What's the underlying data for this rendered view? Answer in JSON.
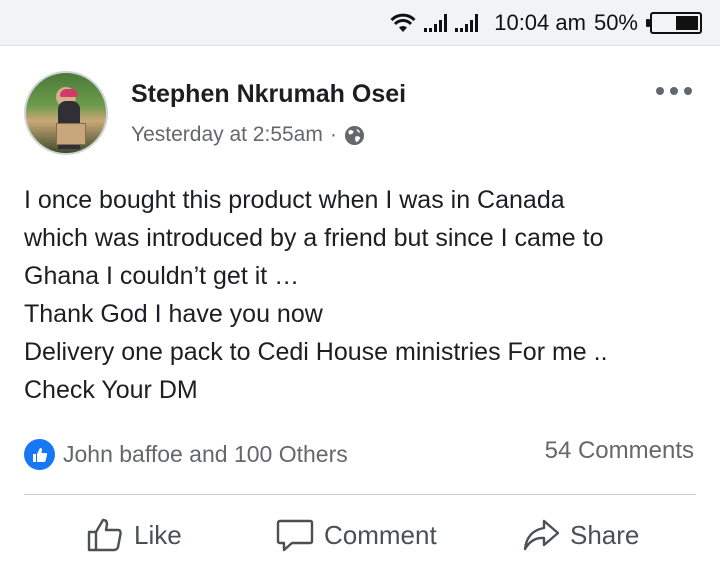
{
  "status_bar": {
    "time": "10:04 am",
    "battery": "50%",
    "battery_level": 0.5,
    "icons": [
      "wifi-icon",
      "signal-icon",
      "signal-icon",
      "battery-icon"
    ]
  },
  "post": {
    "author": "Stephen Nkrumah Osei",
    "timestamp": "Yesterday at 2:55am",
    "separator": "·",
    "audience_icon": "globe-icon",
    "menu_icon": "more-options-icon",
    "lines": [
      "I once bought this product when I was in Canada",
      "which was introduced by a friend but since I came to",
      "Ghana I couldn’t get it …",
      "Thank God I have you now",
      "Delivery one pack to Cedi House ministries For me ..",
      "Check Your DM"
    ],
    "reactions_text": "John baffoe and 100 Others",
    "comments_count": "54 Comments"
  },
  "actions": {
    "like": "Like",
    "comment": "Comment",
    "share": "Share"
  },
  "colors": {
    "accent": "#1877f2",
    "secondary_text": "#65676b",
    "primary_text": "#1c1e21"
  }
}
